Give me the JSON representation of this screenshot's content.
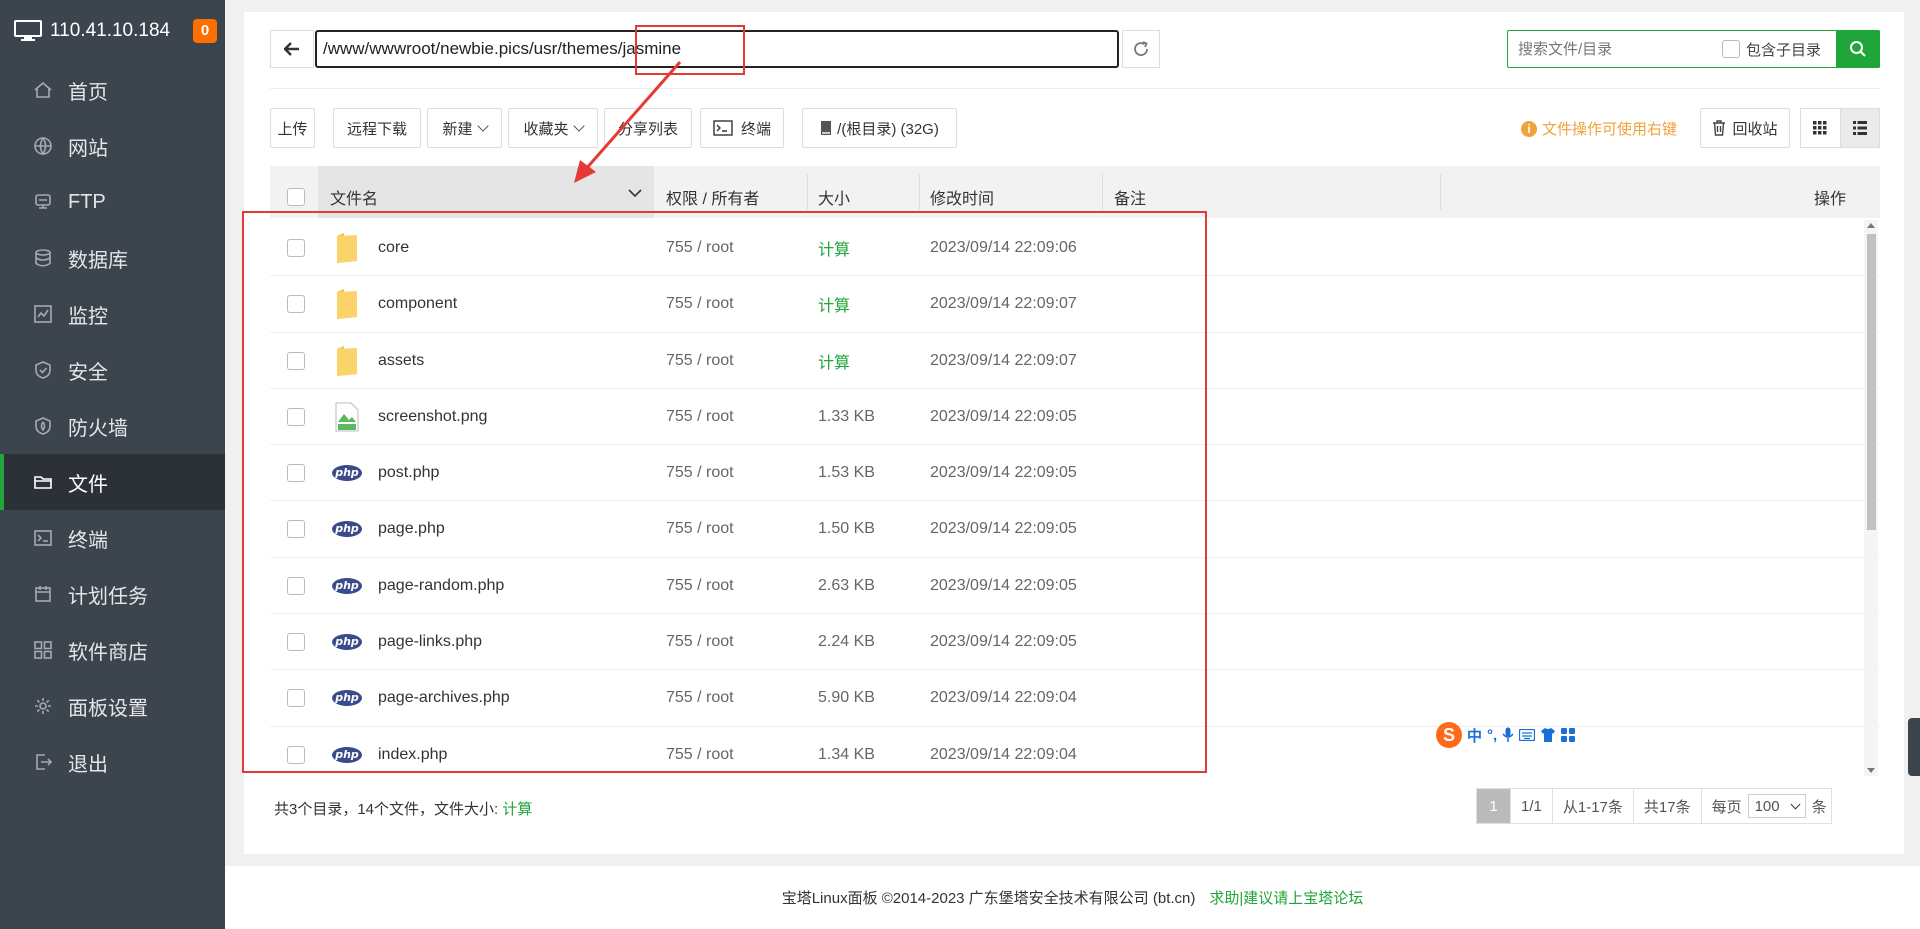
{
  "server": {
    "ip": "110.41.10.184",
    "badge": "0"
  },
  "nav": [
    {
      "label": "首页",
      "icon": "home-icon"
    },
    {
      "label": "网站",
      "icon": "globe-icon"
    },
    {
      "label": "FTP",
      "icon": "ftp-icon"
    },
    {
      "label": "数据库",
      "icon": "database-icon"
    },
    {
      "label": "监控",
      "icon": "monitor-icon"
    },
    {
      "label": "安全",
      "icon": "shield-icon"
    },
    {
      "label": "防火墙",
      "icon": "firewall-icon"
    },
    {
      "label": "文件",
      "icon": "folder-icon",
      "active": true
    },
    {
      "label": "终端",
      "icon": "terminal-icon"
    },
    {
      "label": "计划任务",
      "icon": "calendar-icon"
    },
    {
      "label": "软件商店",
      "icon": "apps-icon"
    },
    {
      "label": "面板设置",
      "icon": "gear-icon"
    },
    {
      "label": "退出",
      "icon": "logout-icon"
    }
  ],
  "path": "/www/wwwroot/newbie.pics/usr/themes/jasmine",
  "search": {
    "placeholder": "搜索文件/目录",
    "subdir_label": "包含子目录"
  },
  "toolbar": {
    "upload": "上传",
    "remote_download": "远程下载",
    "new": "新建",
    "favorites": "收藏夹",
    "share_list": "分享列表",
    "terminal": "终端",
    "disk": "/(根目录) (32G)",
    "tip": "文件操作可使用右键",
    "recycle": "回收站"
  },
  "columns": {
    "name": "文件名",
    "perm": "权限 / 所有者",
    "size": "大小",
    "mtime": "修改时间",
    "note": "备注",
    "ops": "操作"
  },
  "files": [
    {
      "name": "core",
      "type": "folder",
      "perm": "755 / root",
      "size": "计算",
      "mtime": "2023/09/14 22:09:06"
    },
    {
      "name": "component",
      "type": "folder",
      "perm": "755 / root",
      "size": "计算",
      "mtime": "2023/09/14 22:09:07"
    },
    {
      "name": "assets",
      "type": "folder",
      "perm": "755 / root",
      "size": "计算",
      "mtime": "2023/09/14 22:09:07"
    },
    {
      "name": "screenshot.png",
      "type": "png",
      "perm": "755 / root",
      "size": "1.33 KB",
      "mtime": "2023/09/14 22:09:05"
    },
    {
      "name": "post.php",
      "type": "php",
      "perm": "755 / root",
      "size": "1.53 KB",
      "mtime": "2023/09/14 22:09:05"
    },
    {
      "name": "page.php",
      "type": "php",
      "perm": "755 / root",
      "size": "1.50 KB",
      "mtime": "2023/09/14 22:09:05"
    },
    {
      "name": "page-random.php",
      "type": "php",
      "perm": "755 / root",
      "size": "2.63 KB",
      "mtime": "2023/09/14 22:09:05"
    },
    {
      "name": "page-links.php",
      "type": "php",
      "perm": "755 / root",
      "size": "2.24 KB",
      "mtime": "2023/09/14 22:09:05"
    },
    {
      "name": "page-archives.php",
      "type": "php",
      "perm": "755 / root",
      "size": "5.90 KB",
      "mtime": "2023/09/14 22:09:04"
    },
    {
      "name": "index.php",
      "type": "php",
      "perm": "755 / root",
      "size": "1.34 KB",
      "mtime": "2023/09/14 22:09:04"
    }
  ],
  "summary": {
    "text": "共3个目录，14个文件，文件大小: ",
    "calc": "计算"
  },
  "pager": {
    "current": "1",
    "pages": "1/1",
    "range": "从1-17条",
    "total": "共17条",
    "per_page_label": "每页",
    "per_page": "100",
    "unit": "条"
  },
  "ime": {
    "lang": "中",
    "punct": "°,"
  },
  "footer": {
    "copyright": "宝塔Linux面板 ©2014-2023 广东堡塔安全技术有限公司 (bt.cn)",
    "link": "求助|建议请上宝塔论坛"
  },
  "colors": {
    "accent": "#20a53a",
    "sidebar": "#3c444d",
    "annotation": "#e53935",
    "warning": "#f0a23c"
  }
}
